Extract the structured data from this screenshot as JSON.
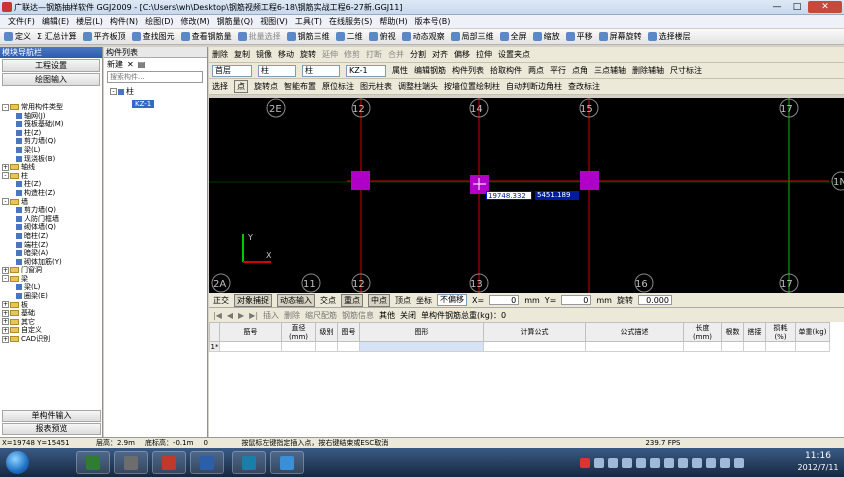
{
  "window": {
    "title": "广联达—钢筋抽样软件 GGJ2009 - [C:\\Users\\wh\\Desktop\\钢筋视频工程6-18\\钢筋实战工程6-27新.GGJ11]",
    "min": "—",
    "max": "□",
    "close": "✕"
  },
  "menu": [
    "文件(F)",
    "编辑(E)",
    "楼层(L)",
    "构件(N)",
    "绘图(D)",
    "修改(M)",
    "钢筋量(Q)",
    "视图(V)",
    "工具(T)",
    "在线服务(S)",
    "帮助(H)",
    "版本号(B)"
  ],
  "toolbar1": [
    "定义",
    "Σ 汇总计算",
    "平齐板顶",
    "查找图元",
    "查看钢筋量",
    "批量选择",
    "钢筋三维",
    "二维",
    "俯视",
    "动态观察",
    "局部三维",
    "全屏",
    "缩放",
    "平移",
    "屏幕旋转",
    "选择楼层"
  ],
  "nav_panel": {
    "header": "模块导航栏",
    "btn1": "工程设置",
    "btn2": "绘图输入",
    "tree": [
      {
        "label": "常用构件类型",
        "level": 0,
        "toggle": "-"
      },
      {
        "label": "轴网(J)",
        "level": 1
      },
      {
        "label": "筏板基础(M)",
        "level": 1
      },
      {
        "label": "柱(Z)",
        "level": 1
      },
      {
        "label": "剪力墙(Q)",
        "level": 1
      },
      {
        "label": "梁(L)",
        "level": 1
      },
      {
        "label": "现浇板(B)",
        "level": 1
      },
      {
        "label": "轴线",
        "level": 0,
        "toggle": "+"
      },
      {
        "label": "柱",
        "level": 0,
        "toggle": "-"
      },
      {
        "label": "柱(Z)",
        "level": 1
      },
      {
        "label": "构造柱(Z)",
        "level": 1
      },
      {
        "label": "墙",
        "level": 0,
        "toggle": "-"
      },
      {
        "label": "剪力墙(Q)",
        "level": 1
      },
      {
        "label": "人防门框墙",
        "level": 1
      },
      {
        "label": "砌体墙(Q)",
        "level": 1
      },
      {
        "label": "暗柱(Z)",
        "level": 1
      },
      {
        "label": "端柱(Z)",
        "level": 1
      },
      {
        "label": "暗梁(A)",
        "level": 1
      },
      {
        "label": "砌体加筋(Y)",
        "level": 1
      },
      {
        "label": "门窗洞",
        "level": 0,
        "toggle": "+"
      },
      {
        "label": "梁",
        "level": 0,
        "toggle": "-"
      },
      {
        "label": "梁(L)",
        "level": 1
      },
      {
        "label": "圈梁(E)",
        "level": 1
      },
      {
        "label": "板",
        "level": 0,
        "toggle": "+"
      },
      {
        "label": "基础",
        "level": 0,
        "toggle": "+"
      },
      {
        "label": "其它",
        "level": 0,
        "toggle": "+"
      },
      {
        "label": "自定义",
        "level": 0,
        "toggle": "+"
      },
      {
        "label": "CAD识别",
        "level": 0,
        "toggle": "+"
      }
    ],
    "foot1": "单构件输入",
    "foot2": "报表预览"
  },
  "comp_panel": {
    "header": "构件列表",
    "new_btn": "新建",
    "search_placeholder": "搜索构件...",
    "tree_root": "柱",
    "tree_item": "KZ-1"
  },
  "toolbar2": [
    "删除",
    "复制",
    "镜像",
    "移动",
    "旋转",
    "延伸",
    "修剪",
    "打断",
    "合并",
    "分割",
    "对齐",
    "偏移",
    "拉伸",
    "设置夹点"
  ],
  "toolbar3": {
    "floor": "首层",
    "type": "柱",
    "subtype": "柱",
    "comp": "KZ-1",
    "items": [
      "属性",
      "编辑钢筋",
      "构件列表",
      "拾取构件",
      "两点",
      "平行",
      "点角",
      "三点辅轴",
      "删除辅轴",
      "尺寸标注"
    ]
  },
  "toolbar4": [
    "选择",
    "点",
    "旋转点",
    "智能布置",
    "原位标注",
    "图元柱表",
    "调整柱端头",
    "按墙位置绘制柱",
    "自动判断边角柱",
    "查改标注"
  ],
  "canvas": {
    "top_labels": [
      "2E",
      "12",
      "14",
      "15",
      "17"
    ],
    "bottom_labels": [
      "2A",
      "11",
      "12",
      "13",
      "16",
      "17"
    ],
    "right_label": "1N",
    "coord_x": "19748.332",
    "coord_y": "5451.189"
  },
  "snap_bar": {
    "items": [
      "正交",
      "对象捕捉",
      "动态输入",
      "交点",
      "重点",
      "中点",
      "顶点",
      "坐标",
      "不偏移"
    ],
    "x_label": "X=",
    "x_val": "0",
    "mm1": "mm",
    "y_label": "Y=",
    "y_val": "0",
    "mm2": "mm",
    "rotate_label": "旋转",
    "rotate_val": "0.000"
  },
  "rebar_toolbar": [
    "插入",
    "删除",
    "缩尺配筋",
    "钢筋信息",
    "其他",
    "关闭",
    "单构件钢筋总重(kg)：0"
  ],
  "rebar_table": {
    "headers": [
      "筋号",
      "直径(mm)",
      "级别",
      "图号",
      "图形",
      "计算公式",
      "公式描述",
      "长度(mm)",
      "根数",
      "搭接",
      "损耗(%)",
      "单重(kg)"
    ],
    "row_marker": "1*"
  },
  "status_bar": {
    "coords": "X=19748 Y=15451",
    "floor_height": "层高：2.9m",
    "bottom_elev": "底标高：-0.1m",
    "zero": "0",
    "hint": "按鼠标左键指定插入点，按右键结束或ESC取消",
    "fps": "239.7 FPS"
  },
  "taskbar": {
    "time": "11:16",
    "date": "2012/7/11",
    "app_colors": [
      "#2e7d32",
      "#6d6d6d",
      "#c0392b",
      "#2b5fa8",
      "#1a7fa8",
      "#3a8fd6"
    ]
  }
}
